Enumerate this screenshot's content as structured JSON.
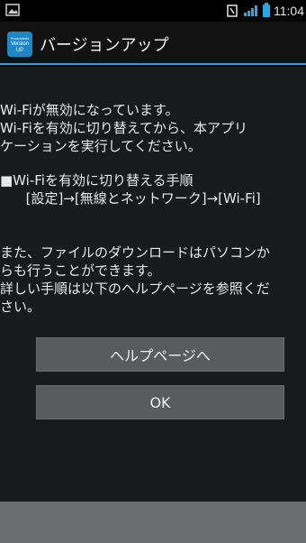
{
  "status_bar": {
    "time": "11:04",
    "icons": [
      "picture-icon",
      "nfc-icon",
      "lte-signal-icon",
      "battery-icon"
    ]
  },
  "action_bar": {
    "icon_text_line1": "ProductInfo",
    "icon_text_line2": "Version",
    "icon_text_line3": "UP",
    "title": "バージョンアップ",
    "accent_color": "#2aa3d6"
  },
  "message": {
    "line1": "Wi-Fiが無効になっています。\nWi-Fiを有効に切り替えてから、本アプリ\nケーションを実行してください。",
    "line2": "■Wi-Fiを有効に切り替える手順\n      [設定]→[無線とネットワーク]→[Wi-Fi]",
    "line3": "また、ファイルのダウンロードはパソコンか\nらも行うことができます。\n詳しい手順は以下のヘルプページを参照くだ\nさい。"
  },
  "buttons": {
    "help_label": "ヘルプページへ",
    "ok_label": "OK"
  }
}
